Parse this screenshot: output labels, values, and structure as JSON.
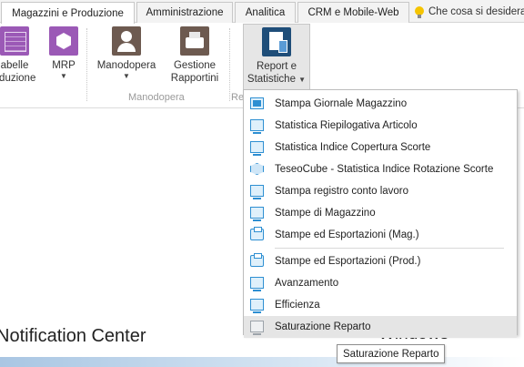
{
  "tabs": [
    {
      "label": "Magazzini e Produzione",
      "active": true
    },
    {
      "label": "Amministrazione",
      "active": false
    },
    {
      "label": "Analitica",
      "active": false
    },
    {
      "label": "CRM e Mobile-Web",
      "active": false
    }
  ],
  "tell_me": "Che cosa si desidera",
  "ribbon": {
    "tabelle_line1": "abelle",
    "tabelle_line2": "oduzione",
    "mrp": "MRP",
    "manodopera": "Manodopera",
    "gestione_line1": "Gestione",
    "gestione_line2": "Rapportini",
    "report_line1": "Report e",
    "report_line2": "Statistiche",
    "group_manodopera": "Manodopera",
    "group_re": "Re"
  },
  "menu": {
    "items": [
      {
        "label": "Stampa Giornale Magazzino",
        "icon": "journal-icon"
      },
      {
        "label": "Statistica Riepilogativa Articolo",
        "icon": "window-icon"
      },
      {
        "label": "Statistica Indice Copertura Scorte",
        "icon": "window-icon"
      },
      {
        "label": "TeseoCube - Statistica Indice Rotazione Scorte",
        "icon": "cube-icon"
      },
      {
        "label": "Stampa registro conto lavoro",
        "icon": "window-icon"
      },
      {
        "label": "Stampe di Magazzino",
        "icon": "window-icon"
      },
      {
        "label": "Stampe ed Esportazioni (Mag.)",
        "icon": "printer-icon"
      },
      {
        "label": "Stampe ed Esportazioni (Prod.)",
        "icon": "printer-icon"
      },
      {
        "label": "Avanzamento",
        "icon": "window-icon"
      },
      {
        "label": "Efficienza",
        "icon": "window-icon"
      },
      {
        "label": "Saturazione Reparto",
        "icon": "window-icon"
      }
    ]
  },
  "tooltip": "Saturazione Reparto",
  "background": {
    "notification_center": "Notification Center",
    "windows": "Windows"
  },
  "colors": {
    "purple_icon": "#9b59b6",
    "brown_icon": "#6d5a50",
    "report_icon": "#1f4e79",
    "accent_blue": "#2e8fd2"
  }
}
